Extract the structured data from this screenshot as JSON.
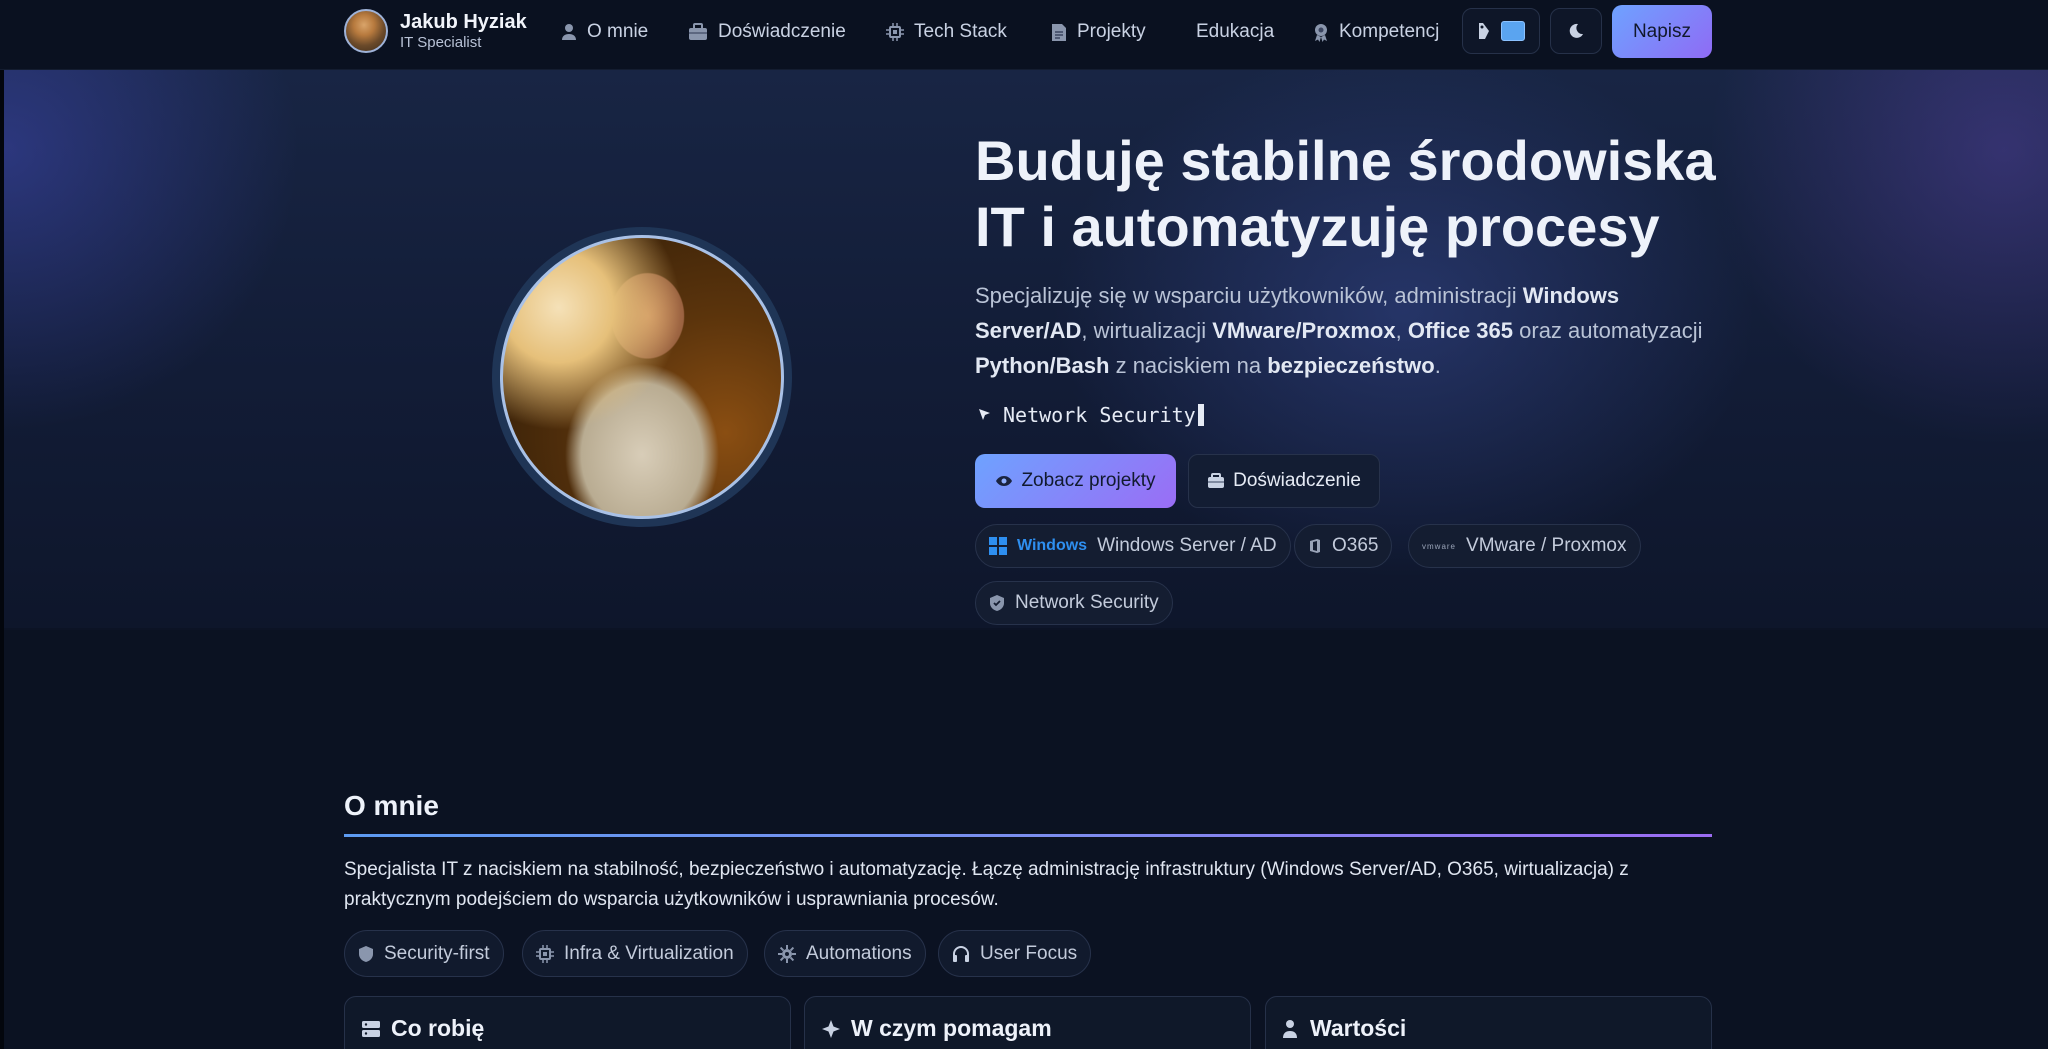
{
  "brand": {
    "name": "Jakub Hyziak",
    "role": "IT Specialist"
  },
  "nav": {
    "items": [
      {
        "label": "O mnie",
        "icon": "user-icon"
      },
      {
        "label": "Doświadczenie",
        "icon": "briefcase-icon"
      },
      {
        "label": "Tech Stack",
        "icon": "cpu-icon"
      },
      {
        "label": "Projekty",
        "icon": "document-icon"
      },
      {
        "label": "Edukacja"
      },
      {
        "label": "Kompetencj",
        "icon": "badge-icon"
      }
    ],
    "cta": "Napisz"
  },
  "hero": {
    "title_line1": "Buduję stabilne środowiska",
    "title_line2": "IT i automatyzuję procesy",
    "desc": {
      "p1": "Specjalizuję się w wsparciu użytkowników, administracji ",
      "b1": "Windows Server/AD",
      "p2": ", wirtualizacji ",
      "b2": "VMware/Proxmox",
      "p3": ", ",
      "b3": "Office 365",
      "p4": " oraz automatyzacji ",
      "b4": "Python/Bash",
      "p5": " z naciskiem na ",
      "b5": "bezpieczeństwo",
      "p6": "."
    },
    "typing": "Network Security",
    "btn_projects": "Zobacz projekty",
    "btn_experience": "Doświadczenie",
    "chips": {
      "windows_logo_text": "Windows",
      "windows": "Windows Server / AD",
      "o365": "O365",
      "vmware_logo_text": "vmware",
      "vmware": "VMware / Proxmox",
      "security": "Network Security"
    }
  },
  "about": {
    "title": "O mnie",
    "text": "Specjalista IT z naciskiem na stabilność, bezpieczeństwo i automatyzację. Łączę administrację infrastruktury (Windows Server/AD, O365, wirtualizacja) z praktycznym podejściem do wsparcia użytkowników i usprawniania procesów.",
    "tags": [
      "Security-first",
      "Infra & Virtualization",
      "Automations",
      "User Focus"
    ],
    "cards": [
      "Co robię",
      "W czym pomagam",
      "Wartości"
    ]
  },
  "colors": {
    "accent_start": "#6ea2ff",
    "accent_end": "#9a6df5",
    "background": "#0b1222",
    "hero_background": "#182544"
  }
}
